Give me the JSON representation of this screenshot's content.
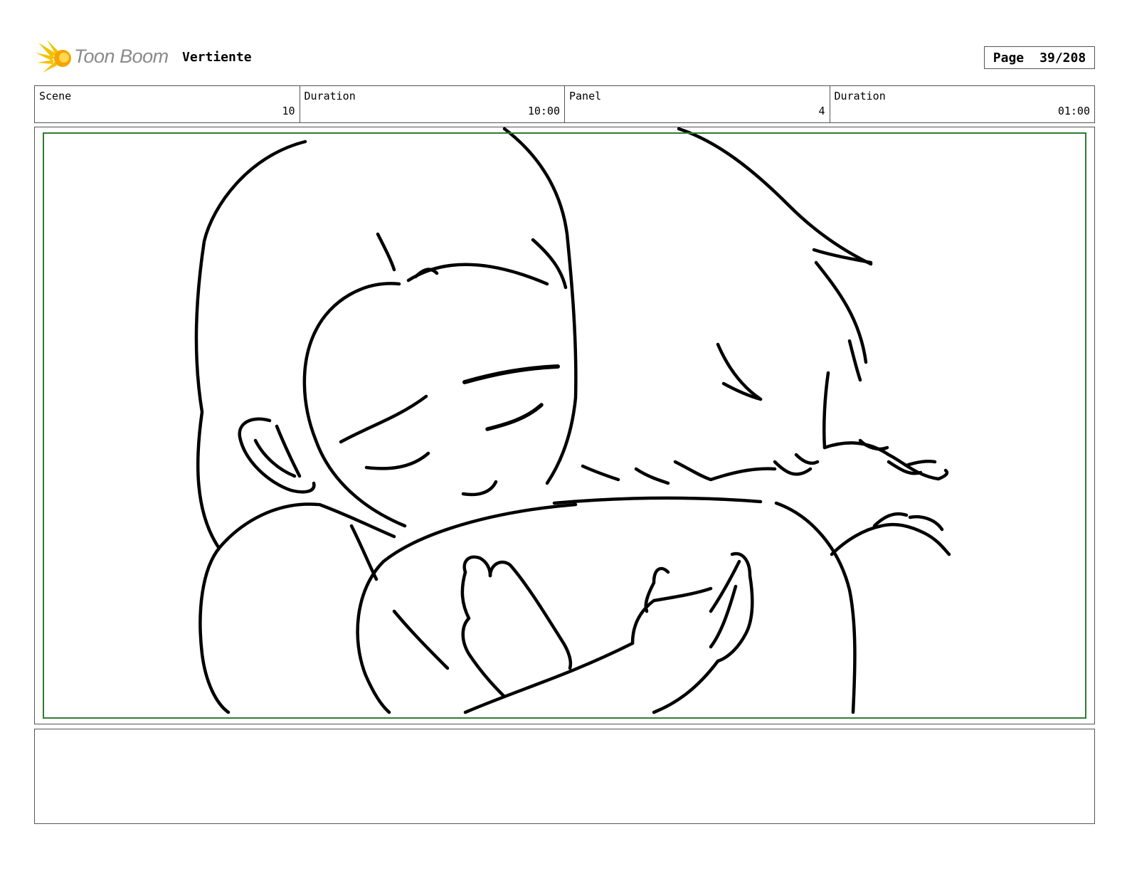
{
  "header": {
    "logo_text": "Toon Boom",
    "logo_icon": "sunburst-logo-icon",
    "project_title": "Vertiente",
    "page_label": "Page",
    "page_number": "39/208"
  },
  "info": [
    {
      "label": "Scene",
      "value": "10"
    },
    {
      "label": "Duration",
      "value": "10:00"
    },
    {
      "label": "Panel",
      "value": "4"
    },
    {
      "label": "Duration",
      "value": "01:00"
    }
  ],
  "panel": {
    "image": "storyboard-sketch-two-girls-hugging",
    "safe_area_color": "#2e7d32"
  },
  "notes": {
    "text": ""
  }
}
